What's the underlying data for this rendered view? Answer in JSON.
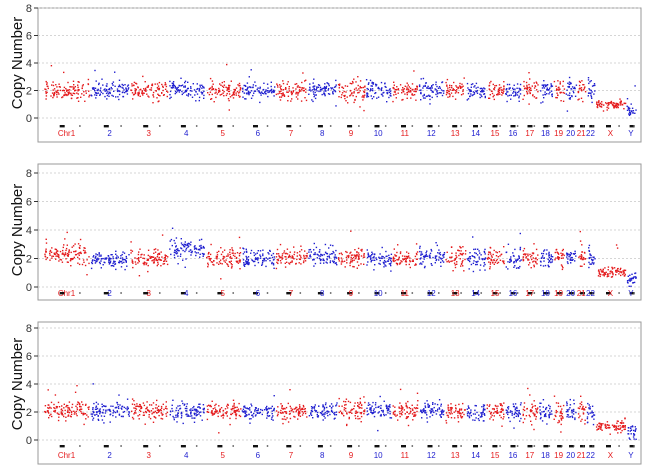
{
  "chart_data": [
    {
      "type": "scatter",
      "ylabel": "Copy Number",
      "ylim": [
        0,
        8
      ],
      "yticks": [
        "0",
        "2",
        "4",
        "6",
        "8"
      ],
      "grid": "horizontal dashed",
      "series_colors": {
        "odd_chromosomes": "#e41a1c",
        "even_chromosomes": "#1f1fcf"
      },
      "chromosomes": [
        {
          "label": "Chr1",
          "mean": 2.0,
          "spread": 0.32
        },
        {
          "label": "2",
          "mean": 2.0,
          "spread": 0.32
        },
        {
          "label": "3",
          "mean": 2.0,
          "spread": 0.32
        },
        {
          "label": "4",
          "mean": 2.1,
          "spread": 0.32
        },
        {
          "label": "5",
          "mean": 2.0,
          "spread": 0.32
        },
        {
          "label": "6",
          "mean": 2.0,
          "spread": 0.32
        },
        {
          "label": "7",
          "mean": 2.0,
          "spread": 0.35
        },
        {
          "label": "8",
          "mean": 2.1,
          "spread": 0.32
        },
        {
          "label": "9",
          "mean": 2.0,
          "spread": 0.4
        },
        {
          "label": "10",
          "mean": 2.0,
          "spread": 0.32
        },
        {
          "label": "11",
          "mean": 2.0,
          "spread": 0.32
        },
        {
          "label": "12",
          "mean": 2.0,
          "spread": 0.32
        },
        {
          "label": "13",
          "mean": 2.1,
          "spread": 0.35
        },
        {
          "label": "14",
          "mean": 2.0,
          "spread": 0.35
        },
        {
          "label": "15",
          "mean": 2.0,
          "spread": 0.35
        },
        {
          "label": "16",
          "mean": 1.9,
          "spread": 0.35
        },
        {
          "label": "17",
          "mean": 2.0,
          "spread": 0.35
        },
        {
          "label": "18",
          "mean": 2.0,
          "spread": 0.35
        },
        {
          "label": "19",
          "mean": 2.0,
          "spread": 0.4
        },
        {
          "label": "20",
          "mean": 2.0,
          "spread": 0.35
        },
        {
          "label": "21",
          "mean": 2.1,
          "spread": 0.4
        },
        {
          "label": "22",
          "mean": 2.0,
          "spread": 0.4
        },
        {
          "label": "X",
          "mean": 1.0,
          "spread": 0.2
        },
        {
          "label": "Y",
          "mean": 0.6,
          "spread": 0.25
        }
      ]
    },
    {
      "type": "scatter",
      "ylabel": "Copy Number",
      "ylim": [
        0,
        8
      ],
      "yticks": [
        "0",
        "2",
        "4",
        "6",
        "8"
      ],
      "grid": "horizontal dashed",
      "series_colors": {
        "odd_chromosomes": "#e41a1c",
        "even_chromosomes": "#1f1fcf"
      },
      "chromosomes": [
        {
          "label": "Chr1",
          "mean": 2.3,
          "spread": 0.35
        },
        {
          "label": "2",
          "mean": 1.9,
          "spread": 0.3
        },
        {
          "label": "3",
          "mean": 2.0,
          "spread": 0.3
        },
        {
          "label": "4",
          "mean": 2.6,
          "spread": 0.35
        },
        {
          "label": "5",
          "mean": 2.0,
          "spread": 0.35
        },
        {
          "label": "6",
          "mean": 2.0,
          "spread": 0.35
        },
        {
          "label": "7",
          "mean": 2.1,
          "spread": 0.35
        },
        {
          "label": "8",
          "mean": 2.1,
          "spread": 0.35
        },
        {
          "label": "9",
          "mean": 2.1,
          "spread": 0.3
        },
        {
          "label": "10",
          "mean": 2.0,
          "spread": 0.3
        },
        {
          "label": "11",
          "mean": 2.0,
          "spread": 0.3
        },
        {
          "label": "12",
          "mean": 2.1,
          "spread": 0.35
        },
        {
          "label": "13",
          "mean": 2.2,
          "spread": 0.45
        },
        {
          "label": "14",
          "mean": 2.0,
          "spread": 0.4
        },
        {
          "label": "15",
          "mean": 2.0,
          "spread": 0.35
        },
        {
          "label": "16",
          "mean": 1.9,
          "spread": 0.35
        },
        {
          "label": "17",
          "mean": 2.1,
          "spread": 0.35
        },
        {
          "label": "18",
          "mean": 2.0,
          "spread": 0.35
        },
        {
          "label": "19",
          "mean": 2.1,
          "spread": 0.35
        },
        {
          "label": "20",
          "mean": 2.1,
          "spread": 0.35
        },
        {
          "label": "21",
          "mean": 2.2,
          "spread": 0.4
        },
        {
          "label": "22",
          "mean": 2.1,
          "spread": 0.4
        },
        {
          "label": "X",
          "mean": 1.0,
          "spread": 0.2
        },
        {
          "label": "Y",
          "mean": 0.6,
          "spread": 0.25
        }
      ]
    },
    {
      "type": "scatter",
      "ylabel": "Copy Number",
      "ylim": [
        0,
        8
      ],
      "yticks": [
        "0",
        "2",
        "4",
        "6",
        "8"
      ],
      "grid": "horizontal dashed",
      "series_colors": {
        "odd_chromosomes": "#e41a1c",
        "even_chromosomes": "#1f1fcf"
      },
      "chromosomes": [
        {
          "label": "Chr1",
          "mean": 2.1,
          "spread": 0.32
        },
        {
          "label": "2",
          "mean": 2.1,
          "spread": 0.32
        },
        {
          "label": "3",
          "mean": 2.1,
          "spread": 0.32
        },
        {
          "label": "4",
          "mean": 2.0,
          "spread": 0.3
        },
        {
          "label": "5",
          "mean": 2.0,
          "spread": 0.3
        },
        {
          "label": "6",
          "mean": 2.0,
          "spread": 0.3
        },
        {
          "label": "7",
          "mean": 2.0,
          "spread": 0.32
        },
        {
          "label": "8",
          "mean": 2.1,
          "spread": 0.32
        },
        {
          "label": "9",
          "mean": 2.2,
          "spread": 0.45
        },
        {
          "label": "10",
          "mean": 2.1,
          "spread": 0.32
        },
        {
          "label": "11",
          "mean": 2.1,
          "spread": 0.32
        },
        {
          "label": "12",
          "mean": 2.1,
          "spread": 0.32
        },
        {
          "label": "13",
          "mean": 2.0,
          "spread": 0.32
        },
        {
          "label": "14",
          "mean": 2.0,
          "spread": 0.32
        },
        {
          "label": "15",
          "mean": 2.1,
          "spread": 0.32
        },
        {
          "label": "16",
          "mean": 2.0,
          "spread": 0.35
        },
        {
          "label": "17",
          "mean": 2.1,
          "spread": 0.35
        },
        {
          "label": "18",
          "mean": 2.0,
          "spread": 0.35
        },
        {
          "label": "19",
          "mean": 2.0,
          "spread": 0.4
        },
        {
          "label": "20",
          "mean": 2.1,
          "spread": 0.35
        },
        {
          "label": "21",
          "mean": 2.1,
          "spread": 0.4
        },
        {
          "label": "22",
          "mean": 2.0,
          "spread": 0.4
        },
        {
          "label": "X",
          "mean": 1.0,
          "spread": 0.2
        },
        {
          "label": "Y",
          "mean": 0.6,
          "spread": 0.25
        }
      ]
    }
  ]
}
